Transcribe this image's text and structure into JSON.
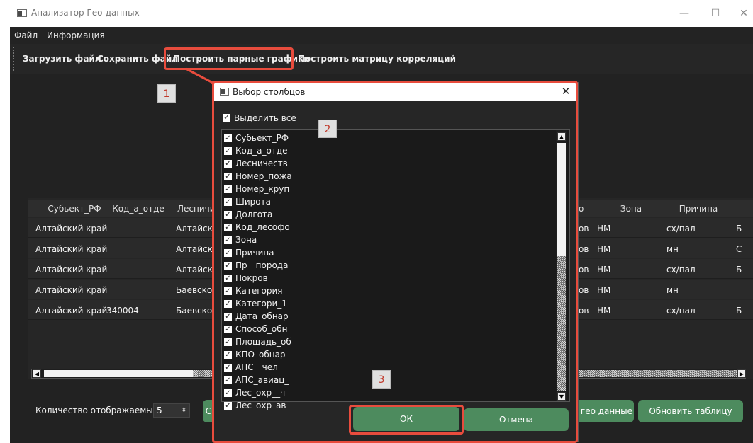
{
  "window": {
    "title": "Анализатор Гео-данных",
    "controls": [
      "—",
      "☐",
      "✕"
    ]
  },
  "menu": {
    "items": [
      "Файл",
      "Информация"
    ]
  },
  "toolbar": {
    "load": "Загрузить файл",
    "save": "Сохранить файл",
    "pair_plots": "Построить парные графики",
    "corr_matrix": "Построить матрицу корреляций"
  },
  "table": {
    "headers": [
      "Субьект_РФ",
      "Код_а_отде",
      "Лесничи",
      "о",
      "Зона",
      "Причина"
    ],
    "rows": [
      [
        "Алтайский край",
        "",
        "Алтайско",
        "ов",
        "НМ",
        "сх/пал",
        "Б"
      ],
      [
        "Алтайский край",
        "",
        "Алтайско",
        "ов",
        "НМ",
        "мн",
        "С"
      ],
      [
        "Алтайский край",
        "",
        "Алтайско",
        "ов",
        "НМ",
        "сх/пал",
        "Б"
      ],
      [
        "Алтайский край",
        "",
        "Баевское",
        "ов",
        "НМ",
        "мн",
        ""
      ],
      [
        "Алтайский край",
        "340004",
        "Баевское",
        "ов",
        "НМ",
        "сх/пал",
        "Б"
      ]
    ]
  },
  "bottom": {
    "rows_label": "Количество отображаемых с",
    "rows_value": "5",
    "left_button": "С",
    "geo_button": "ь гео данные",
    "refresh_button": "Обновить таблицу"
  },
  "dialog": {
    "title": "Выбор столбцов",
    "select_all": "Выделить все",
    "columns": [
      "Субьект_РФ",
      "Код_а_отде",
      "Лесничеств",
      "Номер_пожа",
      "Номер_круп",
      "Широта",
      "Долгота",
      "Код_лесофо",
      "Зона",
      "Причина",
      "Пр__порода",
      "Покров",
      "Категория",
      "Категори_1",
      "Дата_обнар",
      "Способ_обн",
      "Площадь_об",
      "КПО_обнар_",
      "АПС__чел_",
      "АПС_авиац_",
      "Лес_охр__ч",
      "Лес_охр_ав"
    ],
    "ok": "ОК",
    "cancel": "Отмена"
  },
  "annotations": {
    "badges": [
      "1",
      "2",
      "3"
    ],
    "color": "#e84c3d"
  },
  "colors": {
    "accent_green": "#4d8b5e",
    "dark_bg": "#222222"
  }
}
